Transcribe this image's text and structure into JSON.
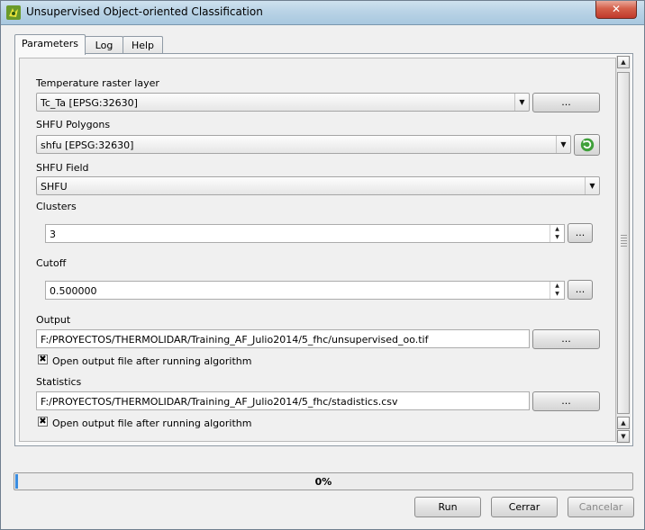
{
  "window": {
    "title": "Unsupervised Object-oriented Classification",
    "close_label": "✕",
    "icon": "qgis-icon"
  },
  "tabs": [
    {
      "label": "Parameters",
      "active": true
    },
    {
      "label": "Log",
      "active": false
    },
    {
      "label": "Help",
      "active": false
    }
  ],
  "params": {
    "temp_raster": {
      "label": "Temperature raster layer",
      "value": "Tc_Ta [EPSG:32630]",
      "browse": "..."
    },
    "shfu_polygons": {
      "label": "SHFU Polygons",
      "value": "shfu [EPSG:32630]"
    },
    "shfu_field": {
      "label": "SHFU Field",
      "value": "SHFU"
    },
    "clusters": {
      "label": "Clusters",
      "value": "3",
      "browse": "..."
    },
    "cutoff": {
      "label": "Cutoff",
      "value": "0.500000",
      "browse": "..."
    },
    "output": {
      "label": "Output",
      "value": "F:/PROYECTOS/THERMOLIDAR/Training_AF_Julio2014/5_fhc/unsupervised_oo.tif",
      "browse": "...",
      "open_label": "Open output file after running algorithm",
      "open_checked": true
    },
    "statistics": {
      "label": "Statistics",
      "value": "F:/PROYECTOS/THERMOLIDAR/Training_AF_Julio2014/5_fhc/stadistics.csv",
      "browse": "...",
      "open_label": "Open output file after running algorithm",
      "open_checked": true
    }
  },
  "progress": {
    "text": "0%",
    "value": 0.0
  },
  "buttons": {
    "run": "Run",
    "close": "Cerrar",
    "cancel": "Cancelar"
  },
  "colors": {
    "accent": "#3a8de0",
    "close": "#c0392b",
    "refresh": "#3fa03a"
  }
}
